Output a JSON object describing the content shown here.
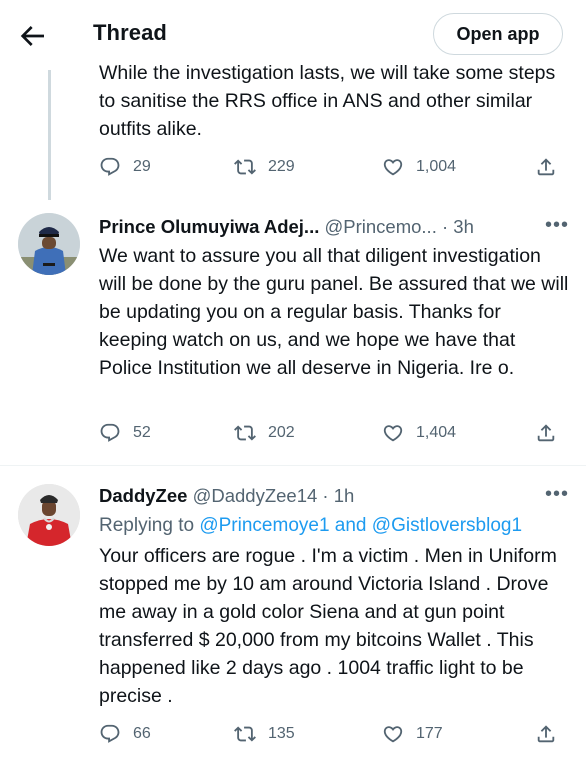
{
  "header": {
    "title": "Thread",
    "open_app_label": "Open app"
  },
  "tweets": [
    {
      "text": "While the investigation lasts, we will take some steps to sanitise the RRS office in ANS and other similar outfits alike.",
      "stats": {
        "replies": "29",
        "retweets": "229",
        "likes": "1,004"
      }
    },
    {
      "name": "Prince Olumuyiwa Adej...",
      "handle": "@Princemo...",
      "time": "· 3h",
      "text": "We want to assure you all that diligent investigation will be done by the guru panel. Be assured that we will be updating you on a regular basis. Thanks for keeping watch on us, and we hope we have that Police Institution we all deserve in Nigeria. Ire o.",
      "stats": {
        "replies": "52",
        "retweets": "202",
        "likes": "1,404"
      }
    },
    {
      "name": "DaddyZee",
      "handle": "@DaddyZee14",
      "time": "· 1h",
      "replying_label": "Replying to",
      "mention_1": "@Princemoye1",
      "mention_and": "and",
      "mention_2": "@Gistloversblog1",
      "text": "Your officers are rogue . I'm a victim . Men in Uniform stopped me by 10 am around Victoria Island . Drove me away in a gold color Siena and at gun point transferred $ 20,000 from my bitcoins Wallet . This happened like 2 days ago .  1004 traffic light to be precise .",
      "stats": {
        "replies": "66",
        "retweets": "135",
        "likes": "177"
      }
    }
  ],
  "more_label": "•••",
  "icons": [
    "back-arrow-icon",
    "reply-icon",
    "retweet-icon",
    "like-icon",
    "share-icon",
    "more-icon"
  ],
  "colors": {
    "secondary_text": "#536471",
    "link": "#1d9bf0",
    "border": "#cfd9de"
  }
}
